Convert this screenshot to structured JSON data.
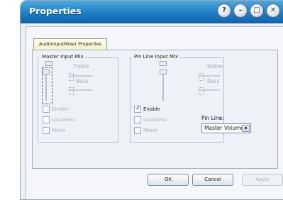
{
  "window": {
    "title": "Properties",
    "controls": {
      "help": "?",
      "minimize": "–",
      "maximize": "□",
      "close": "✕"
    }
  },
  "tab": {
    "label": "AudioInputMixer Properties"
  },
  "master": {
    "label": "Master Input Mix",
    "treble_label": "Treble",
    "bass_label": "Bass",
    "checkboxes": [
      {
        "label": "Enable",
        "checked": false
      },
      {
        "label": "Loudness",
        "checked": false
      },
      {
        "label": "Mono",
        "checked": false
      }
    ]
  },
  "pin": {
    "label": "Pin Line Input Mix",
    "treble_label": "Treble",
    "bass_label": "Bass",
    "checkboxes": [
      {
        "label": "Enable",
        "checked": true
      },
      {
        "label": "Loudness",
        "checked": false
      },
      {
        "label": "Mono",
        "checked": false
      }
    ],
    "pin_line_label": "Pin Line:",
    "pin_line_value": "Master Volume"
  },
  "buttons": {
    "ok": "OK",
    "cancel": "Cancel",
    "apply": "Apply"
  },
  "icons": {
    "checkmark": "✓",
    "dropdown": "◆"
  },
  "colors": {
    "title_bar": "#1f7fc3",
    "tab_underline": "#2e9e4a"
  }
}
